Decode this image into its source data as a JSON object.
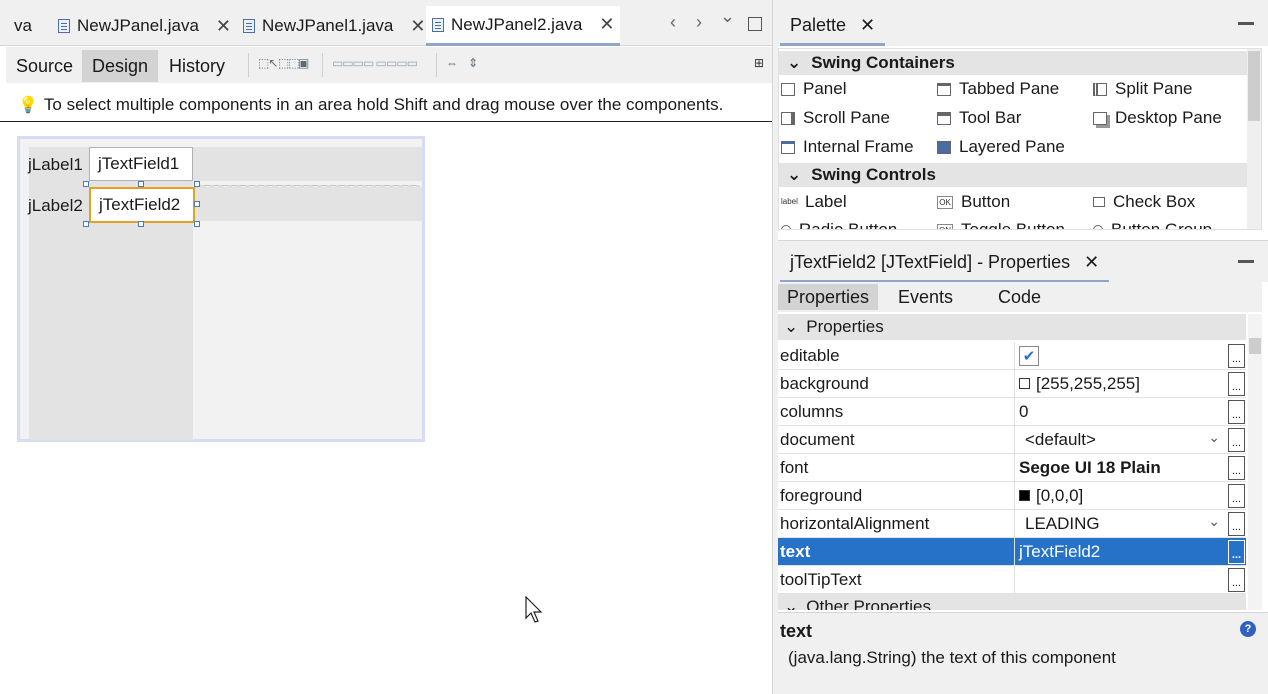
{
  "editor": {
    "tabs": [
      {
        "label": "va",
        "close": ""
      },
      {
        "label": "NewJPanel.java",
        "close": "✕"
      },
      {
        "label": "NewJPanel1.java",
        "close": "✕"
      },
      {
        "label": "NewJPanel2.java",
        "close": "✕"
      }
    ],
    "nav": {
      "prev": "‹",
      "next": "›",
      "list": "⌄"
    },
    "views": [
      "Source",
      "Design",
      "History"
    ],
    "selected_view": "Design",
    "hint": "To select multiple components in an area hold Shift and drag mouse over the components.",
    "form": {
      "label1": "jLabel1",
      "label2": "jLabel2",
      "textfield1": "jTextField1",
      "textfield2": "jTextField2"
    }
  },
  "palette": {
    "title": "Palette",
    "close": "✕",
    "categories": [
      {
        "name": "Swing Containers",
        "items": [
          "Panel",
          "Tabbed Pane",
          "Split Pane",
          "Scroll Pane",
          "Tool Bar",
          "Desktop Pane",
          "Internal Frame",
          "Layered Pane"
        ]
      },
      {
        "name": "Swing Controls",
        "items": [
          "Label",
          "Button",
          "Check Box",
          "Radio Button",
          "Toggle Button",
          "Button Group"
        ]
      }
    ]
  },
  "properties": {
    "title": "jTextField2 [JTextField] - Properties",
    "close": "✕",
    "tabs": [
      "Properties",
      "Events",
      "Code"
    ],
    "selected_tab": "Properties",
    "section": "Properties",
    "rows": [
      {
        "name": "editable",
        "value": "",
        "kind": "checkbox",
        "checked": true
      },
      {
        "name": "background",
        "value": "[255,255,255]",
        "kind": "color",
        "color": "#ffffff"
      },
      {
        "name": "columns",
        "value": "0",
        "kind": "text"
      },
      {
        "name": "document",
        "value": "<default>",
        "kind": "combo"
      },
      {
        "name": "font",
        "value": "Segoe UI 18 Plain",
        "kind": "bold"
      },
      {
        "name": "foreground",
        "value": "[0,0,0]",
        "kind": "color",
        "color": "#000000"
      },
      {
        "name": "horizontalAlignment",
        "value": "LEADING",
        "kind": "combo"
      },
      {
        "name": "text",
        "value": "jTextField2",
        "kind": "text",
        "selected": true
      },
      {
        "name": "toolTipText",
        "value": "",
        "kind": "text"
      }
    ],
    "next_section": "Other Properties",
    "dots": "...",
    "description": {
      "title": "text",
      "text": "(java.lang.String) the text of this component"
    }
  },
  "colors": {
    "selection": "#2672c8",
    "accent_tab": "#8fa6c8",
    "selected_field_border": "#e4a020"
  }
}
